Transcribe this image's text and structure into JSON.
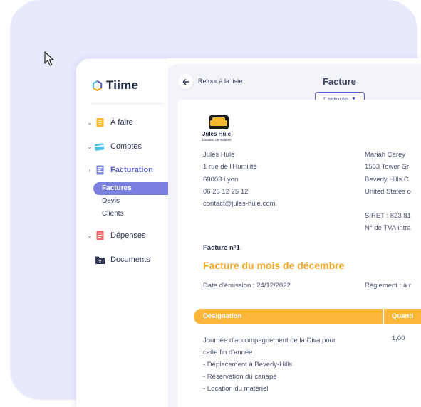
{
  "app": {
    "name": "Tiime"
  },
  "sidebar": {
    "items": [
      {
        "label": "À faire",
        "icon": "clipboard-icon",
        "color": "#f5b82e"
      },
      {
        "label": "Comptes",
        "icon": "card-icon",
        "color": "#4fc0e8"
      },
      {
        "label": "Facturation",
        "icon": "invoice-icon",
        "color": "#7a7fe0"
      },
      {
        "label": "Dépenses",
        "icon": "receipt-icon",
        "color": "#f0696e"
      },
      {
        "label": "Documents",
        "icon": "folder-icon",
        "color": "#2e3454"
      }
    ],
    "subitems": [
      {
        "label": "Factures"
      },
      {
        "label": "Devis"
      },
      {
        "label": "Clients"
      }
    ]
  },
  "header": {
    "back_label": "Retour à la liste",
    "title": "Facture",
    "status": "Facturée"
  },
  "invoice": {
    "logo": {
      "name": "Jules Hule",
      "tagline": "Location de matériel"
    },
    "sender": [
      "Jules Hule",
      "1 rue de l'Humilité",
      "69003 Lyon",
      "06 25 12 25 12",
      "contact@jules-hule.com"
    ],
    "recipient": [
      "Mariah Carey",
      "1553 Tower Gr",
      "Beverly Hills C",
      "United States o"
    ],
    "legal": [
      "SIRET : 823 81",
      "N° de TVA intra"
    ],
    "number": "Facture n°1",
    "title": "Facture du mois de décembre",
    "issue_date": "Date d'émission : 24/12/2022",
    "payment": "Règlement : à r",
    "table": {
      "headers": [
        "Désignation",
        "Quanti"
      ],
      "rows": [
        {
          "description": [
            "Journée d'accompagnement de la Diva pour",
            "cette fin d'année",
            "-  Déplacement à Beverly-Hills",
            "-  Réservation du canapé",
            "-  Location du matériel"
          ],
          "quantity": "1,00"
        }
      ]
    }
  },
  "colors": {
    "accent": "#5b5fd6",
    "highlight": "#fbb63b",
    "title": "#f5a623",
    "background": "#e8e9fd"
  }
}
